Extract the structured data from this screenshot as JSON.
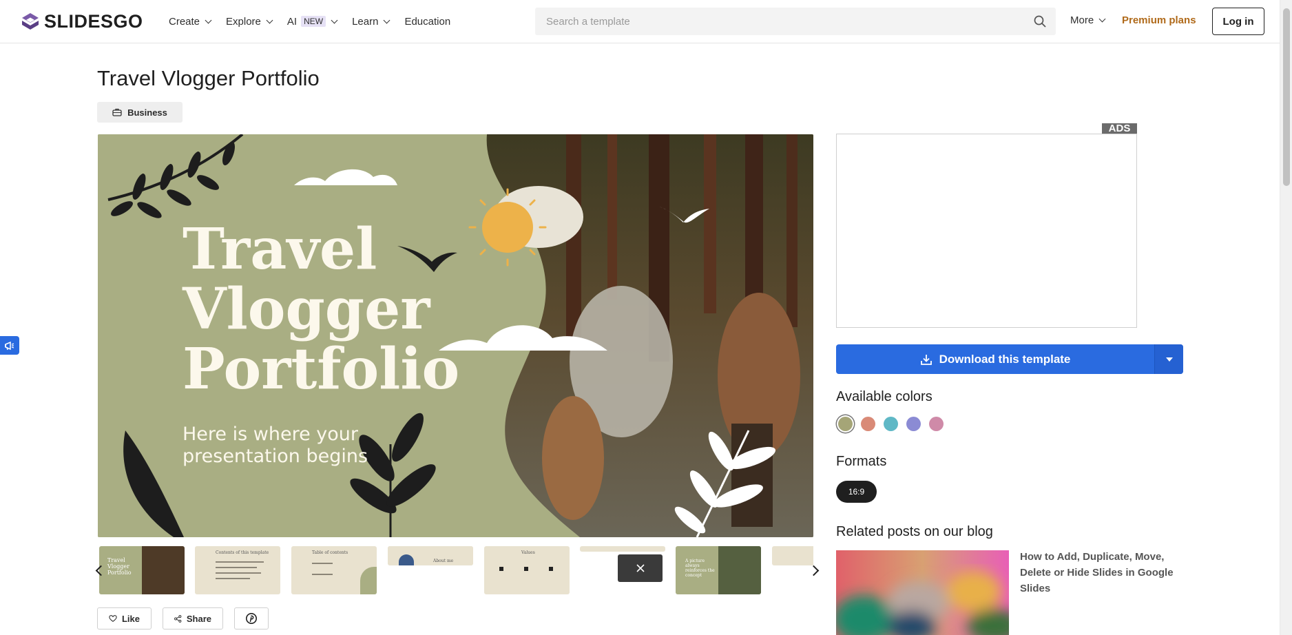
{
  "header": {
    "logo_text": "SLIDESGO",
    "nav": [
      {
        "label": "Create",
        "has_dropdown": true
      },
      {
        "label": "Explore",
        "has_dropdown": true
      },
      {
        "label": "AI",
        "badge": "NEW",
        "has_dropdown": true
      },
      {
        "label": "Learn",
        "has_dropdown": true
      },
      {
        "label": "Education",
        "has_dropdown": false
      }
    ],
    "search_placeholder": "Search a template",
    "more_label": "More",
    "premium_label": "Premium plans",
    "login_label": "Log in"
  },
  "template": {
    "title": "Travel Vlogger Portfolio",
    "category": "Business",
    "slide_title_lines": [
      "Travel",
      "Vlogger",
      "Portfolio"
    ],
    "slide_subtitle_lines": [
      "Here is where your",
      "presentation begins"
    ],
    "thumbnails": [
      {
        "title": "Travel Vlogger Portfolio",
        "kind": "cover"
      },
      {
        "title": "Contents of this template",
        "kind": "text"
      },
      {
        "title": "Table of contents",
        "kind": "toc"
      },
      {
        "title": "About me",
        "kind": "banner"
      },
      {
        "title": "Values",
        "kind": "icons"
      },
      {
        "title": "",
        "kind": "banner-partial"
      },
      {
        "title": "A picture always reinforces the concept",
        "kind": "photo"
      },
      {
        "title": "",
        "kind": "cut"
      }
    ]
  },
  "actions": {
    "like_label": "Like",
    "share_label": "Share"
  },
  "sidebar": {
    "ads_label": "ADS",
    "download_label": "Download this template",
    "colors_title": "Available colors",
    "colors": [
      "#a5a577",
      "#d98a77",
      "#5fb8c6",
      "#8b8bd4",
      "#cf8aa8"
    ],
    "formats_title": "Formats",
    "format": "16:9",
    "related_title": "Related posts on our blog",
    "related_posts": [
      {
        "title": "How to Add, Duplicate, Move, Delete or Hide Slides in Google Slides"
      }
    ]
  },
  "colors": {
    "brand_purple": "#6b4e9b",
    "accent_blue": "#2a6be0",
    "premium": "#b06a1a",
    "slide_green": "#a9ae83"
  }
}
